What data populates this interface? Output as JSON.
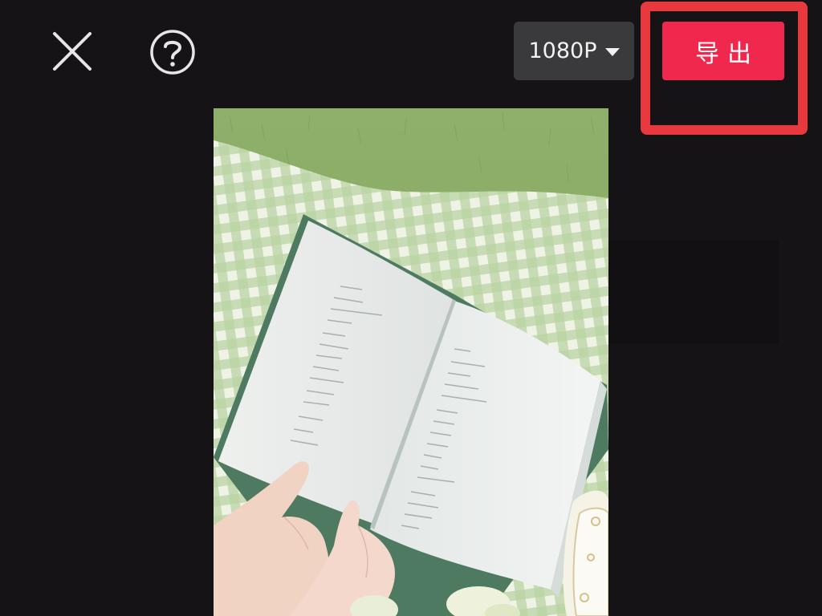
{
  "toolbar": {
    "close_icon": "close-icon",
    "help_icon": "help-icon",
    "resolution": {
      "selected": "1080P",
      "caret_icon": "caret-down-icon"
    },
    "export_label": "导出"
  },
  "preview": {
    "description_icon": "image"
  },
  "colors": {
    "background": "#151315",
    "accent": "#f0284e",
    "highlight": "#e8393f",
    "selector_bg": "#3a393b"
  }
}
